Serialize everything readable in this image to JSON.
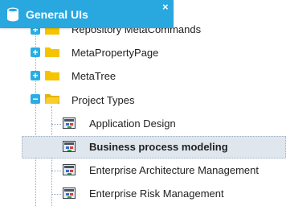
{
  "panel": {
    "title": "General UIs",
    "close_symbol": "×"
  },
  "tree": {
    "folders": [
      {
        "label": "Repository MetaCommands",
        "expanded": false,
        "icon": "folder-icon"
      },
      {
        "label": "MetaPropertyPage",
        "expanded": false,
        "icon": "folder-icon"
      },
      {
        "label": "MetaTree",
        "expanded": false,
        "icon": "folder-icon"
      },
      {
        "label": "Project Types",
        "expanded": true,
        "icon": "folder-open-icon"
      }
    ],
    "toggle_symbols": {
      "collapsed": "+",
      "expanded": "−"
    },
    "children": [
      {
        "label": "Application Design",
        "selected": false,
        "icon": "diagram-icon"
      },
      {
        "label": "Business process modeling",
        "selected": true,
        "icon": "diagram-icon"
      },
      {
        "label": "Enterprise Architecture Management",
        "selected": false,
        "icon": "diagram-icon"
      },
      {
        "label": "Enterprise Risk Management",
        "selected": false,
        "icon": "diagram-icon"
      }
    ]
  },
  "colors": {
    "header_bg": "#29a7df",
    "toggle_bg": "#29aee3",
    "folder_yellow": "#f5c400",
    "selection_bg": "#dfe6ee"
  }
}
